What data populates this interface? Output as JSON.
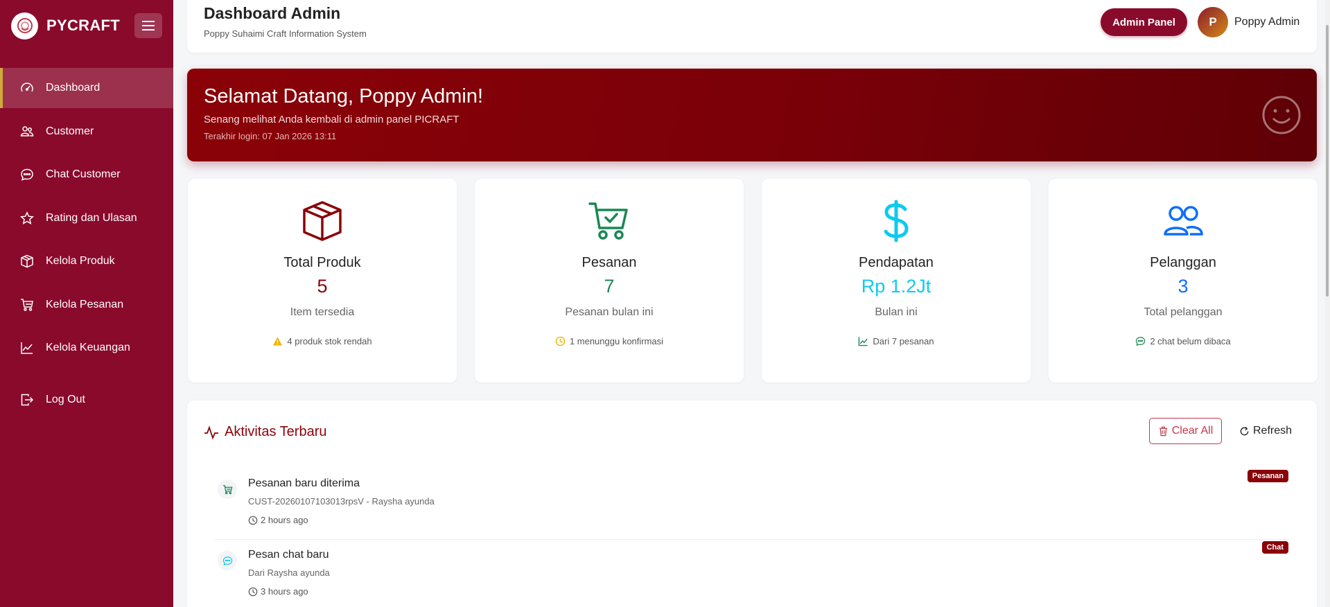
{
  "brand": {
    "name": "PYCRAFT"
  },
  "sidebar": {
    "items": [
      {
        "label": "Dashboard",
        "icon": "speedometer-icon",
        "active": true
      },
      {
        "label": "Customer",
        "icon": "people-icon"
      },
      {
        "label": "Chat Customer",
        "icon": "chat-icon"
      },
      {
        "label": "Rating dan Ulasan",
        "icon": "star-icon"
      },
      {
        "label": "Kelola Produk",
        "icon": "box-icon"
      },
      {
        "label": "Kelola Pesanan",
        "icon": "cart-icon"
      },
      {
        "label": "Kelola Keuangan",
        "icon": "graph-icon"
      }
    ],
    "logout": {
      "label": "Log Out",
      "icon": "logout-icon"
    }
  },
  "header": {
    "title": "Dashboard Admin",
    "subtitle": "Poppy Suhaimi Craft Information System",
    "admin_panel_label": "Admin Panel",
    "avatar_initial": "P",
    "user_name": "Poppy Admin"
  },
  "welcome": {
    "title": "Selamat Datang, Poppy Admin!",
    "subtitle": "Senang melihat Anda kembali di admin panel PICRAFT",
    "last_login": "Terakhir login: 07 Jan 2026 13:11"
  },
  "stats": [
    {
      "title": "Total Produk",
      "value": "5",
      "desc": "Item tersedia",
      "note": "4 produk stok rendah",
      "icon": "box-icon",
      "note_icon": "warning-icon",
      "color": "#8a0208"
    },
    {
      "title": "Pesanan",
      "value": "7",
      "desc": "Pesanan bulan ini",
      "note": "1 menunggu konfirmasi",
      "icon": "cart-check-icon",
      "note_icon": "clock-icon",
      "color": "#198754"
    },
    {
      "title": "Pendapatan",
      "value": "Rp 1.2Jt",
      "desc": "Bulan ini",
      "note": "Dari 7 pesanan",
      "icon": "dollar-icon",
      "note_icon": "graph-up-icon",
      "color": "#0dcaf0"
    },
    {
      "title": "Pelanggan",
      "value": "3",
      "desc": "Total pelanggan",
      "note": "2 chat belum dibaca",
      "icon": "people-icon",
      "note_icon": "chat-dots-icon",
      "color": "#0d6efd"
    }
  ],
  "activity": {
    "title": "Aktivitas Terbaru",
    "clear_label": "Clear All",
    "refresh_label": "Refresh",
    "items": [
      {
        "title": "Pesanan baru diterima",
        "detail": "CUST-20260107103013rpsV - Raysha ayunda",
        "time": "2 hours ago",
        "badge": "Pesanan",
        "icon": "cart-icon"
      },
      {
        "title": "Pesan chat baru",
        "detail": "Dari Raysha ayunda",
        "time": "3 hours ago",
        "badge": "Chat",
        "icon": "chat-dots-icon"
      }
    ]
  },
  "colors": {
    "sidebar": "#8a0a2c",
    "banner": "#7a0008",
    "accent_gold": "#d1a93a"
  }
}
